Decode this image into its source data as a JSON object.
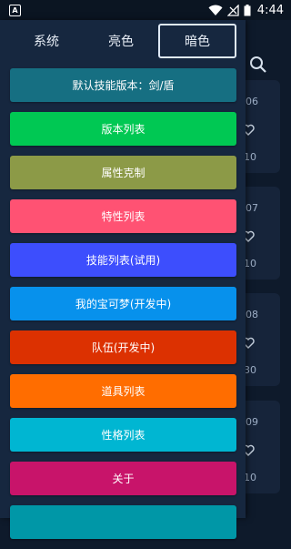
{
  "status_bar": {
    "notification_letter": "A",
    "time": "4:44"
  },
  "theme_selector": {
    "options": [
      {
        "label": "系统"
      },
      {
        "label": "亮色"
      },
      {
        "label": "暗色"
      }
    ],
    "selected": "暗色"
  },
  "menu": {
    "items": [
      {
        "label": "默认技能版本：剑/盾",
        "color": "#166f82"
      },
      {
        "label": "版本列表",
        "color": "#00c853"
      },
      {
        "label": "属性克制",
        "color": "#8c9a47"
      },
      {
        "label": "特性列表",
        "color": "#ff5273"
      },
      {
        "label": "技能列表(试用)",
        "color": "#3d4efd"
      },
      {
        "label": "我的宝可梦(开发中)",
        "color": "#0791ec"
      },
      {
        "label": "队伍(开发中)",
        "color": "#dc3101"
      },
      {
        "label": "道具列表",
        "color": "#ff6d00"
      },
      {
        "label": "性格列表",
        "color": "#00b6d2"
      },
      {
        "label": "关于",
        "color": "#c8146a"
      },
      {
        "label": "",
        "color": "#0097a7"
      }
    ]
  },
  "background_list": {
    "cards": [
      {
        "number": "06",
        "sub": "10"
      },
      {
        "number": "07",
        "sub": "10"
      },
      {
        "number": "08",
        "sub": "30"
      },
      {
        "number": "09",
        "sub": "10"
      }
    ]
  }
}
